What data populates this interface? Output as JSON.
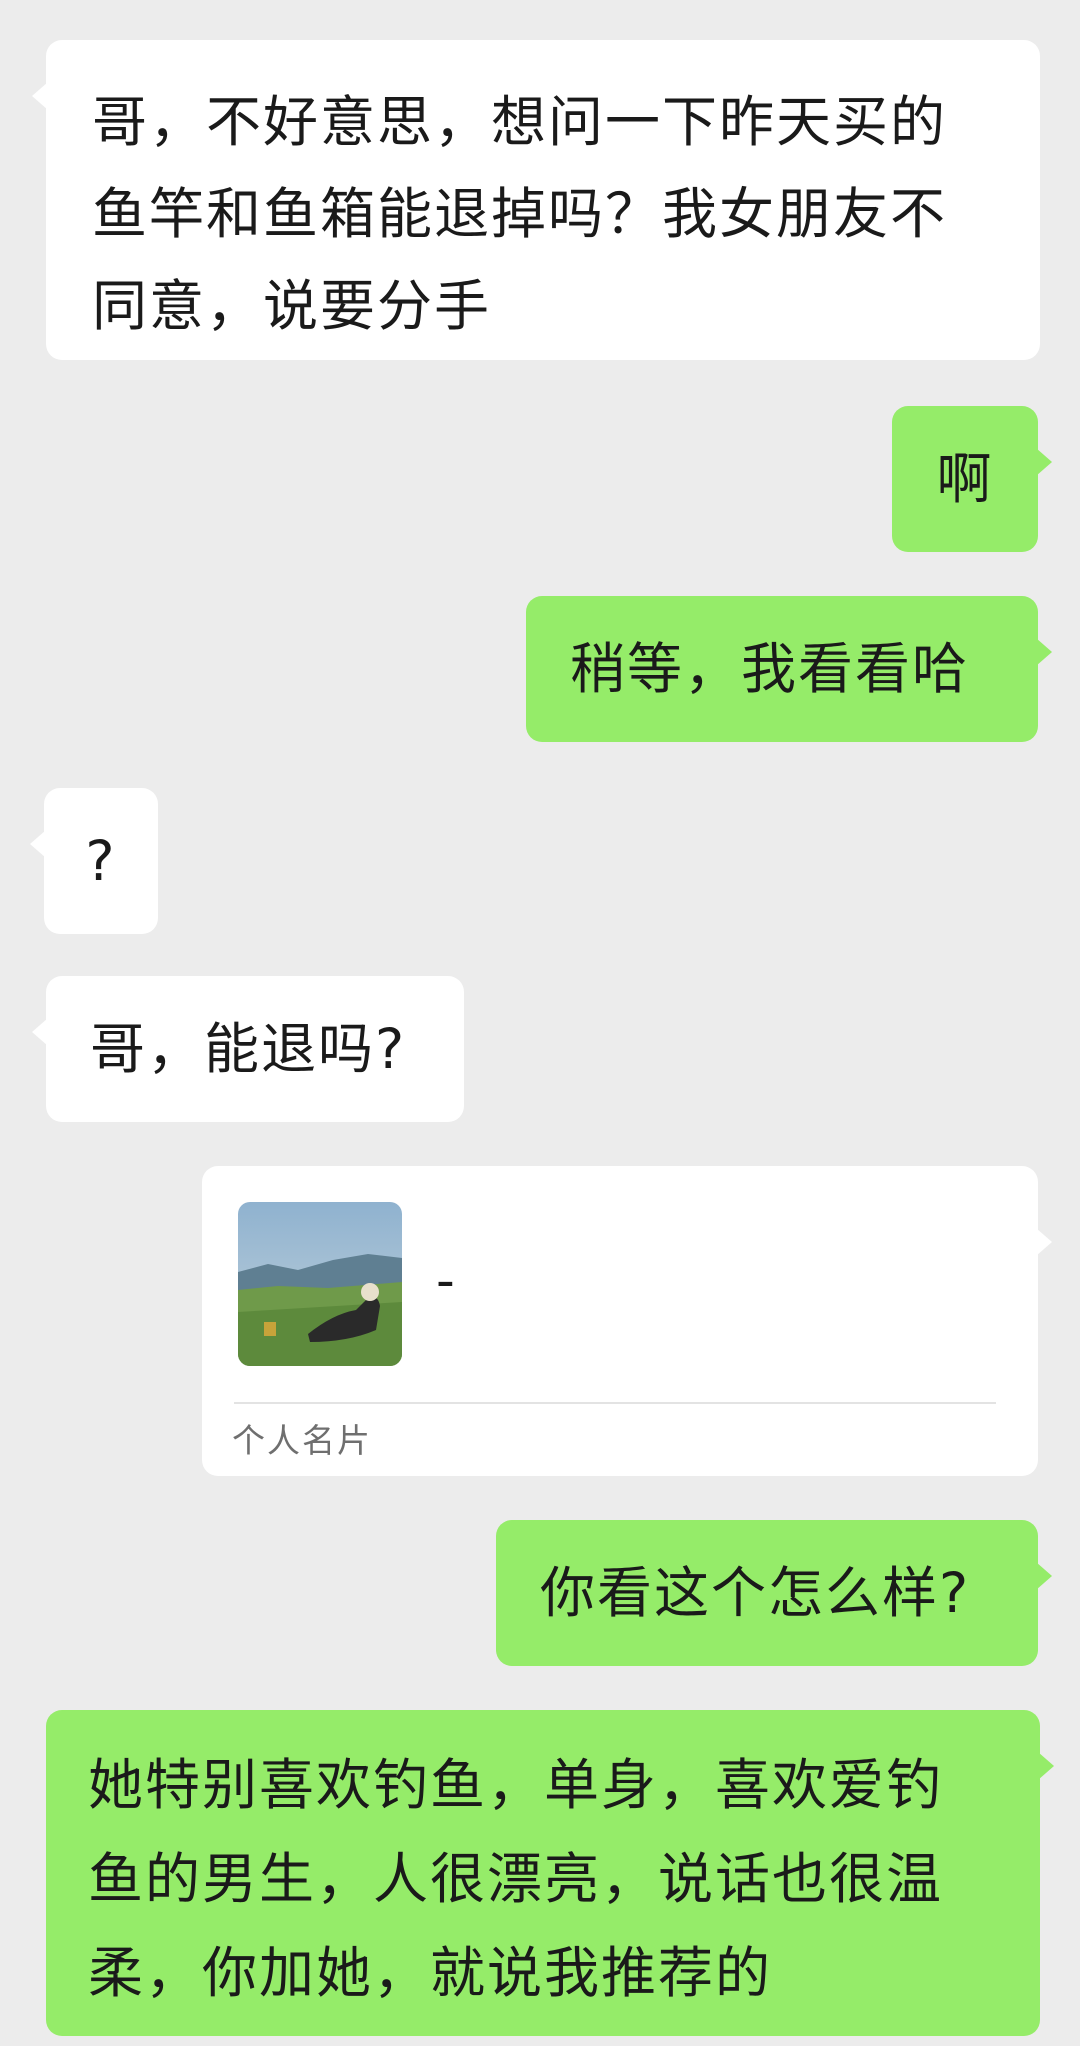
{
  "messages": [
    {
      "id": "m1",
      "side": "incoming",
      "text": "哥，不好意思，想问一下昨天买的鱼竿和鱼箱能退掉吗？我女朋友不同意，说要分手"
    },
    {
      "id": "m2",
      "side": "outgoing",
      "text": "啊"
    },
    {
      "id": "m3",
      "side": "outgoing",
      "text": "稍等，我看看哈"
    },
    {
      "id": "m4",
      "side": "incoming",
      "text": "?"
    },
    {
      "id": "m5",
      "side": "incoming",
      "text": "哥，能退吗?"
    },
    {
      "id": "m6",
      "side": "outgoing",
      "type": "contact_card",
      "name": "-",
      "label": "个人名片",
      "avatar_icon": "contact-avatar-landscape-photo"
    },
    {
      "id": "m7",
      "side": "outgoing",
      "text": "你看这个怎么样?"
    },
    {
      "id": "m8",
      "side": "outgoing",
      "text": "她特别喜欢钓鱼，单身，喜欢爱钓鱼的男生，人很漂亮，说话也很温柔，你加她，就说我推荐的"
    }
  ],
  "colors": {
    "background": "#ececec",
    "incoming_bubble": "#ffffff",
    "outgoing_bubble": "#95ec69",
    "card_label": "#6f6f6f"
  }
}
